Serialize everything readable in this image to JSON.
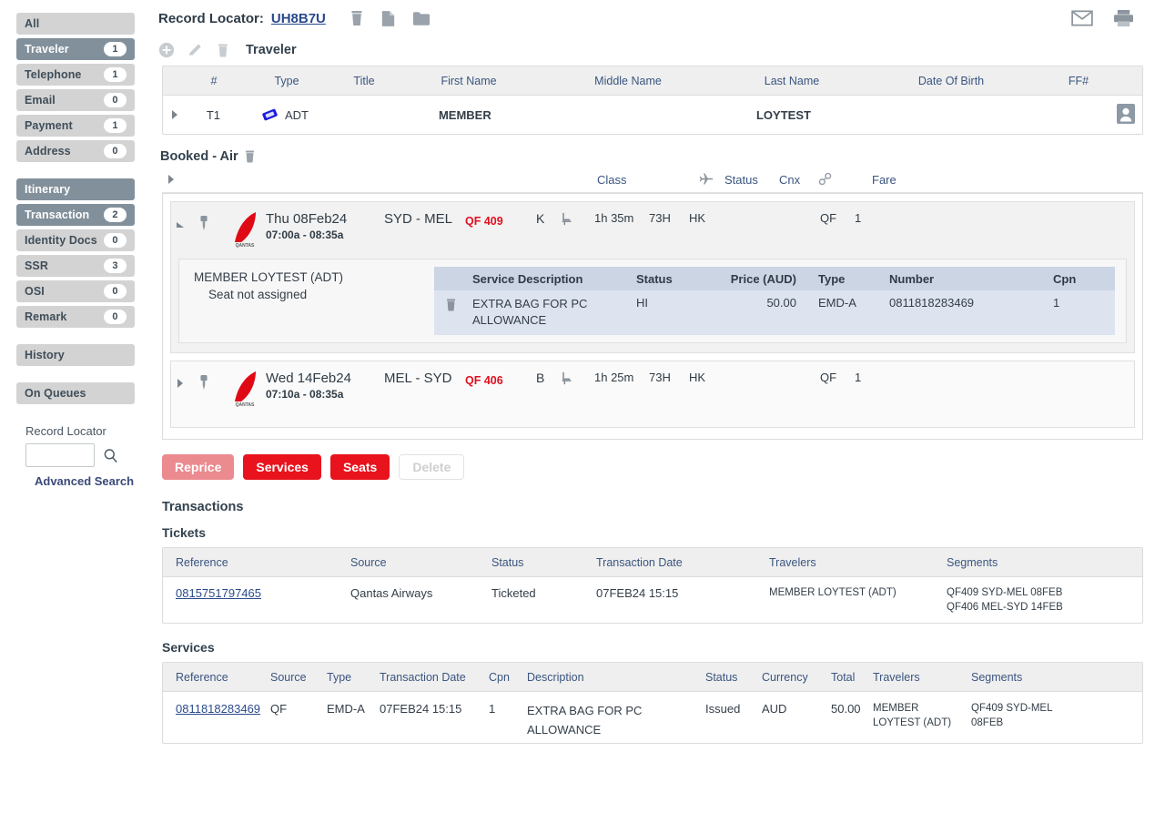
{
  "sidebar": {
    "items": [
      {
        "label": "All",
        "count": null,
        "active": false
      },
      {
        "label": "Traveler",
        "count": "1",
        "active": true
      },
      {
        "label": "Telephone",
        "count": "1",
        "active": false
      },
      {
        "label": "Email",
        "count": "0",
        "active": false
      },
      {
        "label": "Payment",
        "count": "1",
        "active": false
      },
      {
        "label": "Address",
        "count": "0",
        "active": false
      },
      {
        "label": "Itinerary",
        "count": null,
        "active": true
      },
      {
        "label": "Transaction",
        "count": "2",
        "active": true
      },
      {
        "label": "Identity Docs",
        "count": "0",
        "active": false
      },
      {
        "label": "SSR",
        "count": "3",
        "active": false
      },
      {
        "label": "OSI",
        "count": "0",
        "active": false
      },
      {
        "label": "Remark",
        "count": "0",
        "active": false
      }
    ],
    "history_label": "History",
    "queues_label": "On Queues",
    "search": {
      "label": "Record Locator",
      "value": "",
      "placeholder": "",
      "icon": "magnifier-icon",
      "advanced_label": "Advanced Search"
    }
  },
  "header": {
    "record_locator_label": "Record Locator:",
    "record_locator_value": "UH8B7U",
    "icons": [
      "trash-icon",
      "document-icon",
      "folder-icon"
    ],
    "right_icons": [
      "envelope-icon",
      "printer-icon"
    ]
  },
  "traveler_section": {
    "title": "Traveler",
    "toolbar_icons": [
      "add-icon",
      "edit-icon",
      "trash-icon"
    ],
    "columns": [
      "#",
      "Type",
      "Title",
      "First Name",
      "Middle Name",
      "Last Name",
      "Date Of Birth",
      "FF#"
    ],
    "rows": [
      {
        "num": "T1",
        "type_icon": "ticket-icon",
        "type": "ADT",
        "title": "",
        "first_name": "MEMBER",
        "middle_name": "",
        "last_name": "LOYTEST",
        "dob": "",
        "ff": "",
        "row_icon": "person-badge-icon"
      }
    ]
  },
  "booked_air": {
    "title": "Booked - Air",
    "title_icon": "trash-icon",
    "columns": [
      "Class",
      "plane-icon",
      "Status",
      "Cnx",
      "wrench-icon",
      "Fare"
    ],
    "col_class": "Class",
    "col_status": "Status",
    "col_cnx": "Cnx",
    "col_fare": "Fare",
    "segments": [
      {
        "expanded": true,
        "airline_logo": "qantas-logo",
        "date": "Thu 08Feb24",
        "time": "07:00a - 08:35a",
        "route": "SYD - MEL",
        "flight": "QF 409",
        "class": "K",
        "seat_icon": "seat-icon",
        "duration": "1h 35m",
        "equipment": "73H",
        "status": "HK",
        "cnx": "",
        "fare_carrier": "QF",
        "fare_count": "1",
        "service_panel": {
          "pax_name": "MEMBER LOYTEST (ADT)",
          "seat_note": "Seat not assigned",
          "columns": [
            "Service Description",
            "Status",
            "Price (AUD)",
            "Type",
            "Number",
            "Cpn"
          ],
          "rows": [
            {
              "delete_icon": "trash-icon",
              "description": "EXTRA BAG FOR PC ALLOWANCE",
              "status": "HI",
              "price": "50.00",
              "type": "EMD-A",
              "number": "0811818283469",
              "cpn": "1"
            }
          ]
        }
      },
      {
        "expanded": false,
        "airline_logo": "qantas-logo",
        "date": "Wed 14Feb24",
        "time": "07:10a - 08:35a",
        "route": "MEL - SYD",
        "flight": "QF 406",
        "class": "B",
        "seat_icon": "seat-icon",
        "duration": "1h 25m",
        "equipment": "73H",
        "status": "HK",
        "cnx": "",
        "fare_carrier": "QF",
        "fare_count": "1"
      }
    ]
  },
  "buttons": {
    "reprice": "Reprice",
    "services": "Services",
    "seats": "Seats",
    "delete": "Delete"
  },
  "transactions": {
    "title": "Transactions",
    "tickets": {
      "title": "Tickets",
      "columns": [
        "Reference",
        "Source",
        "Status",
        "Transaction Date",
        "Travelers",
        "Segments"
      ],
      "rows": [
        {
          "reference": "0815751797465",
          "source": "Qantas Airways",
          "status": "Ticketed",
          "transaction_date": "07FEB24 15:15",
          "travelers": "MEMBER LOYTEST (ADT)",
          "segments_line1": "QF409 SYD-MEL 08FEB",
          "segments_line2": "QF406 MEL-SYD 14FEB"
        }
      ]
    },
    "services": {
      "title": "Services",
      "columns": [
        "Reference",
        "Source",
        "Type",
        "Transaction Date",
        "Cpn",
        "Description",
        "Status",
        "Currency",
        "Total",
        "Travelers",
        "Segments"
      ],
      "rows": [
        {
          "reference": "0811818283469",
          "source": "QF",
          "type": "EMD-A",
          "transaction_date": "07FEB24 15:15",
          "cpn": "1",
          "description": "EXTRA BAG FOR PC ALLOWANCE",
          "status": "Issued",
          "currency": "AUD",
          "total": "50.00",
          "travelers": "MEMBER LOYTEST (ADT)",
          "segments": "QF409 SYD-MEL 08FEB"
        }
      ]
    }
  },
  "colors": {
    "accent_red": "#e8131d",
    "link_blue": "#2b4a8b",
    "header_blue": "#3a5580",
    "nav_active": "#82909b",
    "nav_inactive": "#d3d3d3"
  }
}
